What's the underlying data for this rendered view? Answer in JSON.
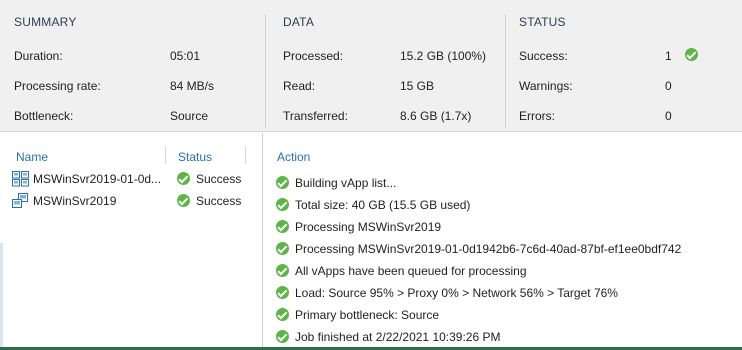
{
  "summary": {
    "title": "SUMMARY",
    "rows": [
      {
        "label": "Duration:",
        "value": "05:01"
      },
      {
        "label": "Processing rate:",
        "value": "84 MB/s"
      },
      {
        "label": "Bottleneck:",
        "value": "Source"
      }
    ]
  },
  "data": {
    "title": "DATA",
    "rows": [
      {
        "label": "Processed:",
        "value": "15.2 GB (100%)"
      },
      {
        "label": "Read:",
        "value": "15 GB"
      },
      {
        "label": "Transferred:",
        "value": "8.6 GB (1.7x)"
      }
    ]
  },
  "status": {
    "title": "STATUS",
    "rows": [
      {
        "label": "Success:",
        "value": "1",
        "icon": "success-check-icon"
      },
      {
        "label": "Warnings:",
        "value": "0"
      },
      {
        "label": "Errors:",
        "value": "0"
      }
    ]
  },
  "vm_list": {
    "headers": {
      "name": "Name",
      "status": "Status"
    },
    "items": [
      {
        "name": "MSWinSvr2019-01-0d...",
        "status": "Success",
        "icon": "vapp-icon"
      },
      {
        "name": "MSWinSvr2019",
        "status": "Success",
        "icon": "vm-icon"
      }
    ]
  },
  "action_log": {
    "header": "Action",
    "items": [
      "Building vApp list...",
      "Total size: 40 GB (15.5 GB used)",
      "Processing MSWinSvr2019",
      "Processing MSWinSvr2019-01-0d1942b6-7c6d-40ad-87bf-ef1ee0bdf742",
      "All vApps have been queued for processing",
      "Load: Source 95% > Proxy 0% > Network 56% > Target 76%",
      "Primary bottleneck: Source",
      "Job finished at 2/22/2021 10:39:26 PM"
    ]
  },
  "colors": {
    "success_green": "#5db548",
    "header_blue": "#2a6ead",
    "panel_gray": "#f0f0f0"
  }
}
